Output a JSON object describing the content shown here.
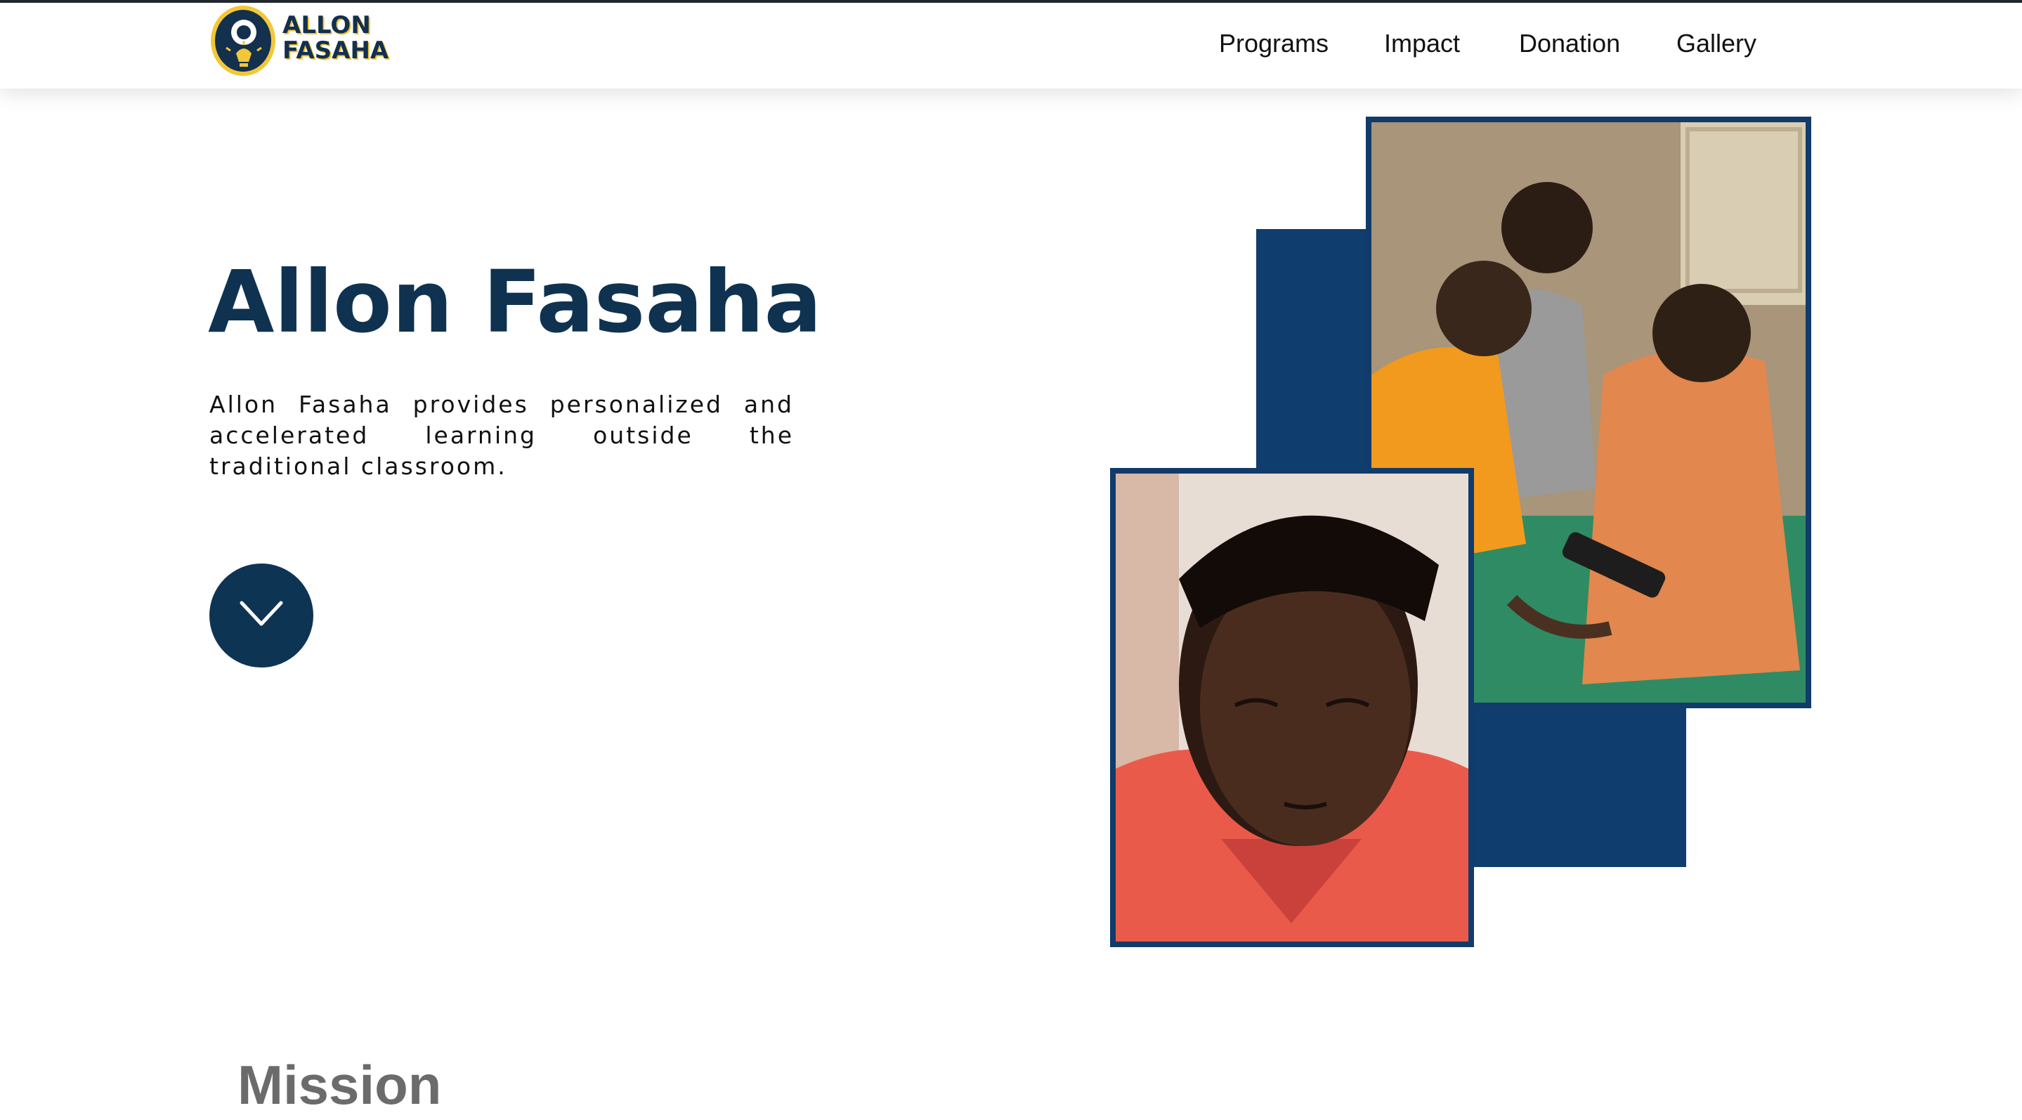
{
  "brand": {
    "logo_line1": "ALLON",
    "logo_line2": "FASAHA",
    "logo_icon": "lightbulb-person-icon",
    "colors": {
      "primary": "#0f3250",
      "accent": "#f3c737"
    }
  },
  "nav": {
    "items": [
      {
        "label": "Programs"
      },
      {
        "label": "Impact"
      },
      {
        "label": "Donation"
      },
      {
        "label": "Gallery"
      }
    ]
  },
  "hero": {
    "title": "Allon Fasaha",
    "description": "Allon Fasaha provides personalized and accelerated learning outside the traditional classroom.",
    "scroll_icon": "chevron-down-icon",
    "photos": [
      {
        "name": "children-using-phone-photo"
      },
      {
        "name": "boy-reading-photo"
      }
    ],
    "block_color": "#0f3d6d"
  },
  "mission": {
    "title": "Mission"
  }
}
